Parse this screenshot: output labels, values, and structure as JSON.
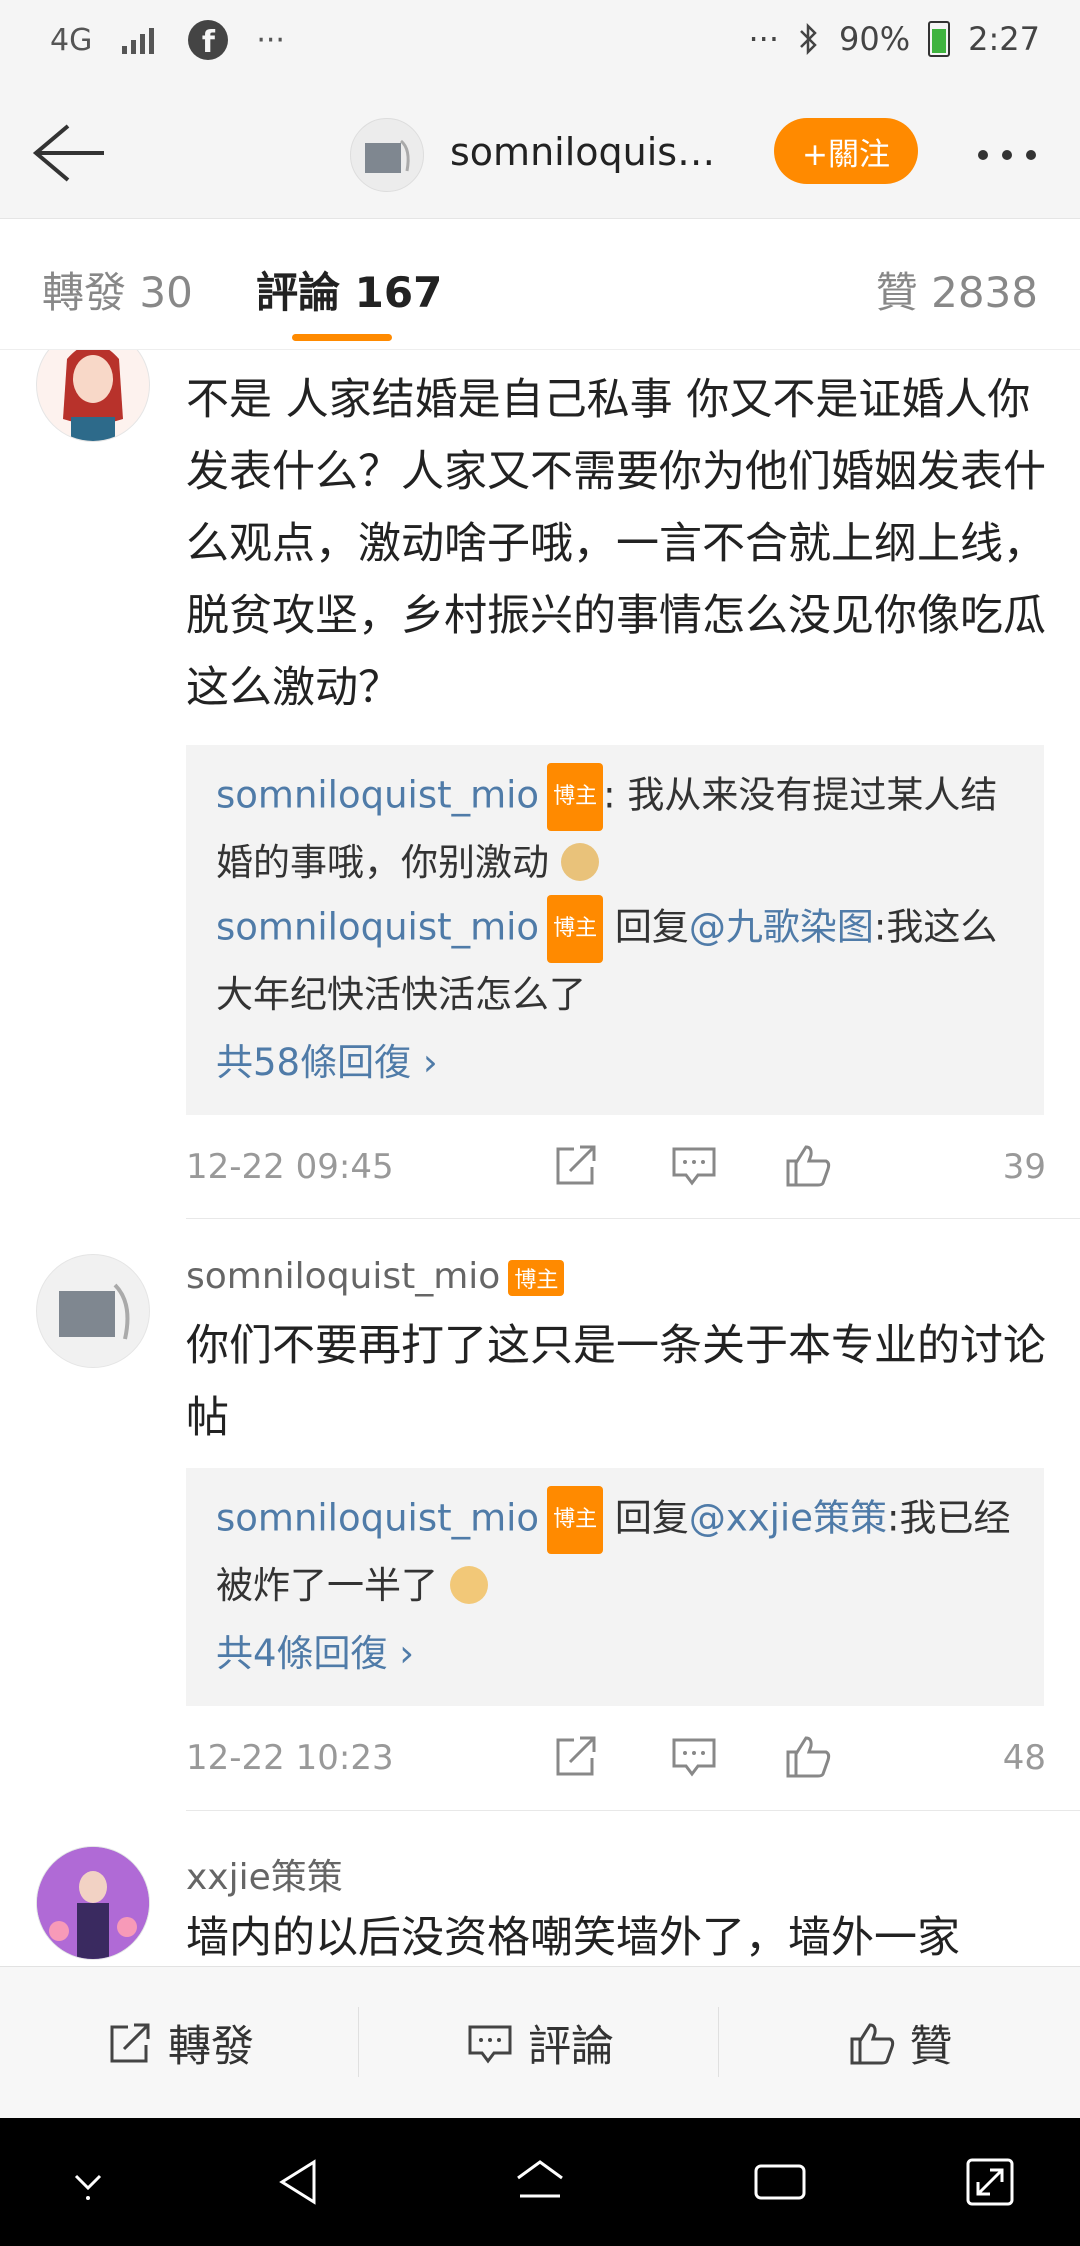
{
  "status_bar": {
    "network": "4G",
    "left_more": "···",
    "right_more": "···",
    "battery": "90%",
    "time": "2:27"
  },
  "header": {
    "title": "somniloquist_...",
    "follow_label": "+關注"
  },
  "tabs": [
    {
      "label": "轉發 30"
    },
    {
      "label": "評論 167"
    },
    {
      "label": "贊 2838"
    }
  ],
  "comments": [
    {
      "username": "",
      "content": "不是 人家结婚是自己私事 你又不是证婚人你发表什么？人家又不需要你为他们婚姻发表什么观点，激动啥子哦，一言不合就上纲上线，脱贫攻坚，乡村振兴的事情怎么没见你像吃瓜这么激动？",
      "replies": [
        {
          "name": "somniloquist_mio",
          "badge": "博主",
          "prefix": ": ",
          "mention": "",
          "text": "我从来没有提过某人结婚的事哦，你别激动"
        },
        {
          "name": "somniloquist_mio",
          "badge": "博主",
          "prefix": " 回复",
          "mention": "@九歌染图",
          "text": ":我这么大年纪快活快活怎么了"
        }
      ],
      "reply_count": "共58條回復 ›",
      "time": "12-22 09:45",
      "likes": "39"
    },
    {
      "username": "somniloquist_mio",
      "badge": "博主",
      "content": "你们不要再打了这只是一条关于本专业的讨论帖",
      "replies": [
        {
          "name": "somniloquist_mio",
          "badge": "博主",
          "prefix": " 回复",
          "mention": "@xxjie策策",
          "text": ":我已经被炸了一半了"
        }
      ],
      "reply_count": "共4條回復 ›",
      "time": "12-22 10:23",
      "likes": "48"
    },
    {
      "username": "xxjie策策",
      "content": "墙内的以后没资格嘲笑墙外了，墙外一家"
    }
  ],
  "bottom_bar": {
    "repost": "轉發",
    "comment": "評論",
    "like": "贊"
  },
  "colors": {
    "accent": "#ff8a00",
    "link": "#4f7ba8"
  }
}
